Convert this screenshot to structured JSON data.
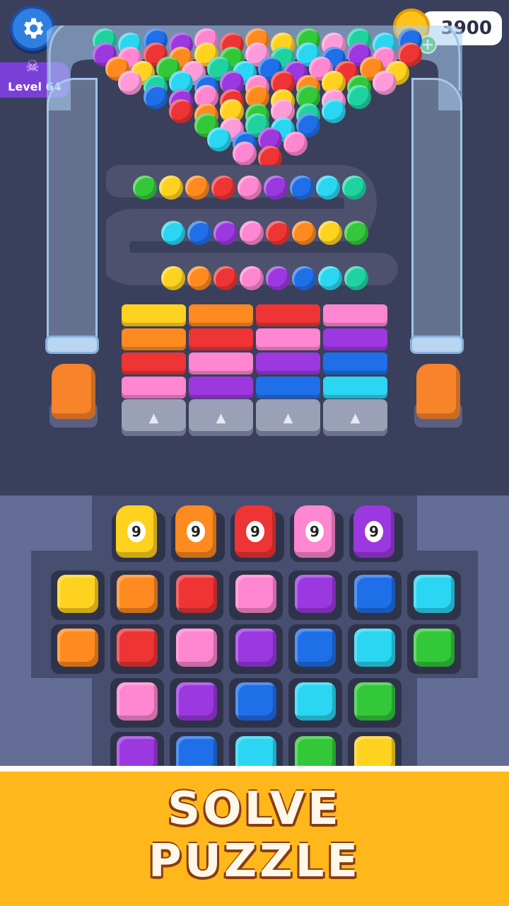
{
  "hud": {
    "coins": "3900",
    "level_label": "Level 64",
    "icons": {
      "settings": "gear-icon",
      "level": "skull-icon",
      "coin": "coin-icon",
      "add": "plus-icon"
    }
  },
  "colors": {
    "yellow": "#ffd21f",
    "orange": "#ff8a1f",
    "red": "#ee3434",
    "pink": "#ff86d0",
    "purple": "#9b38e0",
    "blue": "#1f6fe8",
    "cyan": "#2ad6f2",
    "green": "#33c83a",
    "teal": "#1fd3a0",
    "lightpink": "#ff9bd8"
  },
  "counters": [
    {
      "value": "9",
      "color": "yellow"
    },
    {
      "value": "9",
      "color": "orange"
    },
    {
      "value": "9",
      "color": "red"
    },
    {
      "value": "9",
      "color": "pink"
    },
    {
      "value": "9",
      "color": "purple"
    }
  ],
  "block_rows": [
    [
      "yellow",
      "orange",
      "red",
      "pink"
    ],
    [
      "orange",
      "red",
      "pink",
      "purple"
    ],
    [
      "red",
      "pink",
      "purple",
      "blue"
    ],
    [
      "pink",
      "purple",
      "blue",
      "cyan"
    ]
  ],
  "cube_grid": [
    [
      "yellow",
      "orange",
      "red",
      "pink",
      "purple",
      "blue",
      "cyan"
    ],
    [
      "orange",
      "red",
      "pink",
      "purple",
      "blue",
      "cyan",
      "green"
    ],
    [
      "",
      "pink",
      "purple",
      "blue",
      "cyan",
      "green",
      ""
    ],
    [
      "",
      "purple",
      "blue",
      "cyan",
      "green",
      "yellow",
      ""
    ]
  ],
  "track_top": [
    "green",
    "yellow",
    "orange",
    "red",
    "pink",
    "purple",
    "blue",
    "cyan",
    "teal"
  ],
  "track_mid": [
    "cyan",
    "blue",
    "purple",
    "pink",
    "red",
    "orange",
    "yellow",
    "green"
  ],
  "track_bottom": [
    "yellow",
    "orange",
    "red",
    "pink",
    "purple",
    "blue",
    "cyan",
    "teal"
  ],
  "banner": {
    "line1": "SOLVE",
    "line2": "PUZZLE"
  }
}
